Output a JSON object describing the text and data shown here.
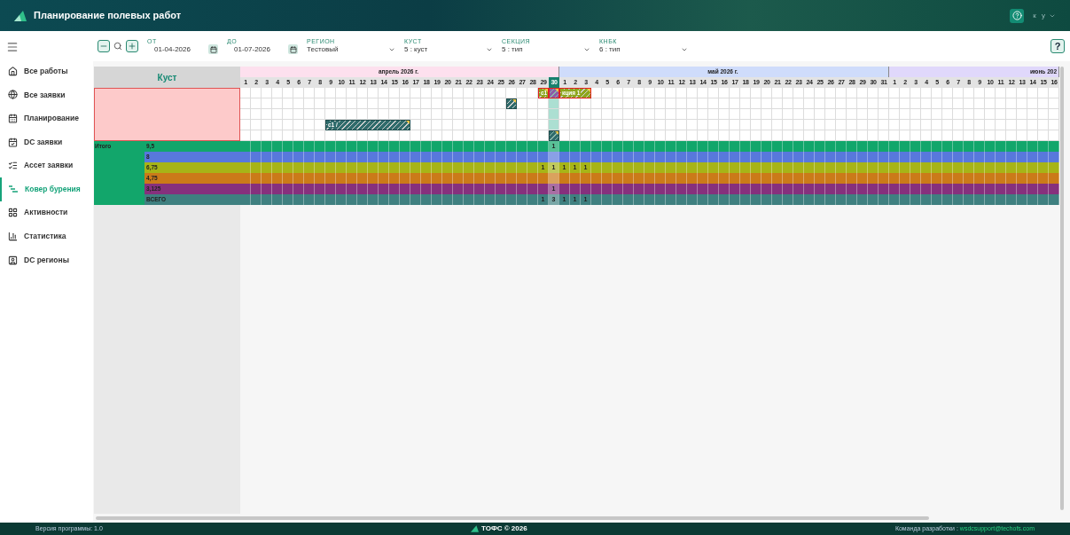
{
  "header": {
    "title": "Планирование полевых работ",
    "user": "к у"
  },
  "sidebar": {
    "items": [
      {
        "label": "Все работы",
        "selected": false
      },
      {
        "label": "Все заявки",
        "selected": false
      },
      {
        "label": "Планирование",
        "selected": false
      },
      {
        "label": "DC заявки",
        "selected": false
      },
      {
        "label": "Ассет заявки",
        "selected": false
      },
      {
        "label": "Ковер бурения",
        "selected": true
      },
      {
        "label": "Активности",
        "selected": false
      },
      {
        "label": "Статистика",
        "selected": false
      },
      {
        "label": "DC регионы",
        "selected": false
      }
    ]
  },
  "toolbar": {
    "date_from": {
      "label": "ОТ",
      "value": "01-04-2026"
    },
    "date_to": {
      "label": "ДО",
      "value": "01-07-2026"
    },
    "selects": [
      {
        "label": "РЕГИОН",
        "value": "Тестовый"
      },
      {
        "label": "КУСТ",
        "value": "5 : куст"
      },
      {
        "label": "СЕКЦИЯ",
        "value": "5 : тип"
      },
      {
        "label": "КНБК",
        "value": "6 : тип"
      }
    ],
    "help": "?"
  },
  "grid": {
    "left_title": "Куст",
    "months": [
      {
        "label": "апрель 2026 г.",
        "color": "#fde0ee",
        "days": [
          {
            "label": "1",
            "selected": false
          },
          {
            "label": "2",
            "selected": false
          },
          {
            "label": "3",
            "selected": false
          },
          {
            "label": "4",
            "selected": false
          },
          {
            "label": "5",
            "selected": false
          },
          {
            "label": "6",
            "selected": false
          },
          {
            "label": "7",
            "selected": false
          },
          {
            "label": "8",
            "selected": false
          },
          {
            "label": "9",
            "selected": false
          },
          {
            "label": "10",
            "selected": false
          },
          {
            "label": "11",
            "selected": false
          },
          {
            "label": "12",
            "selected": false
          },
          {
            "label": "13",
            "selected": false
          },
          {
            "label": "14",
            "selected": false
          },
          {
            "label": "15",
            "selected": false
          },
          {
            "label": "16",
            "selected": false
          },
          {
            "label": "17",
            "selected": false
          },
          {
            "label": "18",
            "selected": false
          },
          {
            "label": "19",
            "selected": false
          },
          {
            "label": "20",
            "selected": false
          },
          {
            "label": "21",
            "selected": false
          },
          {
            "label": "22",
            "selected": false
          },
          {
            "label": "23",
            "selected": false
          },
          {
            "label": "24",
            "selected": false
          },
          {
            "label": "25",
            "selected": false
          },
          {
            "label": "26",
            "selected": false
          },
          {
            "label": "27",
            "selected": false
          },
          {
            "label": "28",
            "selected": false
          },
          {
            "label": "29",
            "selected": false
          },
          {
            "label": "30",
            "selected": true
          }
        ]
      },
      {
        "label": "май 2026 г.",
        "color": "#cfdcfb",
        "days": [
          {
            "label": "1",
            "selected": false
          },
          {
            "label": "2",
            "selected": false
          },
          {
            "label": "3",
            "selected": false
          },
          {
            "label": "4",
            "selected": false
          },
          {
            "label": "5",
            "selected": false
          },
          {
            "label": "6",
            "selected": false
          },
          {
            "label": "7",
            "selected": false
          },
          {
            "label": "8",
            "selected": false
          },
          {
            "label": "9",
            "selected": false
          },
          {
            "label": "10",
            "selected": false
          },
          {
            "label": "11",
            "selected": false
          },
          {
            "label": "12",
            "selected": false
          },
          {
            "label": "13",
            "selected": false
          },
          {
            "label": "14",
            "selected": false
          },
          {
            "label": "15",
            "selected": false
          },
          {
            "label": "16",
            "selected": false
          },
          {
            "label": "17",
            "selected": false
          },
          {
            "label": "18",
            "selected": false
          },
          {
            "label": "19",
            "selected": false
          },
          {
            "label": "20",
            "selected": false
          },
          {
            "label": "21",
            "selected": false
          },
          {
            "label": "22",
            "selected": false
          },
          {
            "label": "23",
            "selected": false
          },
          {
            "label": "24",
            "selected": false
          },
          {
            "label": "25",
            "selected": false
          },
          {
            "label": "26",
            "selected": false
          },
          {
            "label": "27",
            "selected": false
          },
          {
            "label": "28",
            "selected": false
          },
          {
            "label": "29",
            "selected": false
          },
          {
            "label": "30",
            "selected": false
          },
          {
            "label": "31",
            "selected": false
          }
        ]
      },
      {
        "label": "июнь 202",
        "color": "#e0d8fb",
        "days": [
          {
            "label": "1",
            "selected": false
          },
          {
            "label": "2",
            "selected": false
          },
          {
            "label": "3",
            "selected": false
          },
          {
            "label": "4",
            "selected": false
          },
          {
            "label": "5",
            "selected": false
          },
          {
            "label": "6",
            "selected": false
          },
          {
            "label": "7",
            "selected": false
          },
          {
            "label": "8",
            "selected": false
          },
          {
            "label": "9",
            "selected": false
          },
          {
            "label": "10",
            "selected": false
          },
          {
            "label": "11",
            "selected": false
          },
          {
            "label": "12",
            "selected": false
          },
          {
            "label": "13",
            "selected": false
          },
          {
            "label": "14",
            "selected": false
          },
          {
            "label": "15",
            "selected": false
          },
          {
            "label": "16",
            "selected": false
          }
        ]
      }
    ],
    "task_rows": [
      {
        "cells": [
          {
            "kind": "empty"
          },
          {
            "kind": "empty"
          },
          {
            "kind": "empty"
          },
          {
            "kind": "empty"
          },
          {
            "kind": "empty"
          },
          {
            "kind": "empty"
          },
          {
            "kind": "empty"
          },
          {
            "kind": "empty"
          },
          {
            "kind": "empty"
          },
          {
            "kind": "empty"
          },
          {
            "kind": "empty"
          },
          {
            "kind": "empty"
          },
          {
            "kind": "empty"
          },
          {
            "kind": "empty"
          },
          {
            "kind": "empty"
          },
          {
            "kind": "empty"
          },
          {
            "kind": "empty"
          },
          {
            "kind": "empty"
          },
          {
            "kind": "empty"
          },
          {
            "kind": "empty"
          },
          {
            "kind": "empty"
          },
          {
            "kind": "empty"
          },
          {
            "kind": "empty"
          },
          {
            "kind": "empty"
          },
          {
            "kind": "empty"
          },
          {
            "kind": "empty"
          },
          {
            "kind": "empty"
          },
          {
            "kind": "empty"
          },
          {
            "kind": "bar_start",
            "label": "с1",
            "color": "#8ea51c",
            "conflict": true
          },
          {
            "kind": "bar_start",
            "color": "#8e5aa8",
            "conflict": true
          },
          {
            "kind": "bar_start",
            "label": "кция 1",
            "color": "#8ea51c",
            "conflict": true
          },
          {
            "kind": "bar_continue"
          },
          {
            "kind": "bar_continue"
          }
        ]
      },
      {
        "cells": [
          {
            "kind": "empty"
          },
          {
            "kind": "empty"
          },
          {
            "kind": "empty"
          },
          {
            "kind": "empty"
          },
          {
            "kind": "empty"
          },
          {
            "kind": "empty"
          },
          {
            "kind": "empty"
          },
          {
            "kind": "empty"
          },
          {
            "kind": "empty"
          },
          {
            "kind": "empty"
          },
          {
            "kind": "empty"
          },
          {
            "kind": "empty"
          },
          {
            "kind": "empty"
          },
          {
            "kind": "empty"
          },
          {
            "kind": "empty"
          },
          {
            "kind": "empty"
          },
          {
            "kind": "empty"
          },
          {
            "kind": "empty"
          },
          {
            "kind": "empty"
          },
          {
            "kind": "empty"
          },
          {
            "kind": "empty"
          },
          {
            "kind": "empty"
          },
          {
            "kind": "empty"
          },
          {
            "kind": "empty"
          },
          {
            "kind": "empty"
          },
          {
            "kind": "bar_start",
            "color": "#2f6b6b",
            "conflict": false
          }
        ]
      },
      {},
      {
        "cells": [
          {
            "kind": "empty"
          },
          {
            "kind": "empty"
          },
          {
            "kind": "empty"
          },
          {
            "kind": "empty"
          },
          {
            "kind": "empty"
          },
          {
            "kind": "empty"
          },
          {
            "kind": "empty"
          },
          {
            "kind": "empty"
          },
          {
            "kind": "bar_start",
            "label": "с1 /",
            "color": "#2f6b6b",
            "conflict": false
          },
          {
            "kind": "bar_continue"
          },
          {
            "kind": "bar_continue"
          },
          {
            "kind": "bar_continue"
          },
          {
            "kind": "bar_continue"
          },
          {
            "kind": "bar_continue"
          },
          {
            "kind": "bar_continue"
          },
          {
            "kind": "bar_continue"
          }
        ]
      },
      {
        "cells": [
          {
            "kind": "empty"
          },
          {
            "kind": "empty"
          },
          {
            "kind": "empty"
          },
          {
            "kind": "empty"
          },
          {
            "kind": "empty"
          },
          {
            "kind": "empty"
          },
          {
            "kind": "empty"
          },
          {
            "kind": "empty"
          },
          {
            "kind": "empty"
          },
          {
            "kind": "empty"
          },
          {
            "kind": "empty"
          },
          {
            "kind": "empty"
          },
          {
            "kind": "empty"
          },
          {
            "kind": "empty"
          },
          {
            "kind": "empty"
          },
          {
            "kind": "empty"
          },
          {
            "kind": "empty"
          },
          {
            "kind": "empty"
          },
          {
            "kind": "empty"
          },
          {
            "kind": "empty"
          },
          {
            "kind": "empty"
          },
          {
            "kind": "empty"
          },
          {
            "kind": "empty"
          },
          {
            "kind": "empty"
          },
          {
            "kind": "empty"
          },
          {
            "kind": "empty"
          },
          {
            "kind": "empty"
          },
          {
            "kind": "empty"
          },
          {
            "kind": "empty"
          },
          {
            "kind": "bar_start",
            "color": "#2f6b6b",
            "conflict": false
          }
        ]
      }
    ],
    "summary_title": "Итого",
    "summary_rows": [
      {
        "label": "9,5",
        "color": "#12a66b",
        "cells": [
          {
            "kind": "empty"
          },
          {
            "kind": "empty"
          },
          {
            "kind": "empty"
          },
          {
            "kind": "empty"
          },
          {
            "kind": "empty"
          },
          {
            "kind": "empty"
          },
          {
            "kind": "empty"
          },
          {
            "kind": "empty"
          },
          {
            "kind": "empty"
          },
          {
            "kind": "empty"
          },
          {
            "kind": "empty"
          },
          {
            "kind": "empty"
          },
          {
            "kind": "empty"
          },
          {
            "kind": "empty"
          },
          {
            "kind": "empty"
          },
          {
            "kind": "empty"
          },
          {
            "kind": "empty"
          },
          {
            "kind": "empty"
          },
          {
            "kind": "empty"
          },
          {
            "kind": "empty"
          },
          {
            "kind": "empty"
          },
          {
            "kind": "empty"
          },
          {
            "kind": "empty"
          },
          {
            "kind": "empty"
          },
          {
            "kind": "empty"
          },
          {
            "kind": "empty"
          },
          {
            "kind": "empty"
          },
          {
            "kind": "empty"
          },
          {
            "kind": "empty"
          },
          {
            "kind": "count",
            "text": "1"
          }
        ]
      },
      {
        "label": "8",
        "color": "#5878dc"
      },
      {
        "label": "6,75",
        "color": "#a7b417",
        "cells": [
          {
            "kind": "empty"
          },
          {
            "kind": "empty"
          },
          {
            "kind": "empty"
          },
          {
            "kind": "empty"
          },
          {
            "kind": "empty"
          },
          {
            "kind": "empty"
          },
          {
            "kind": "empty"
          },
          {
            "kind": "empty"
          },
          {
            "kind": "empty"
          },
          {
            "kind": "empty"
          },
          {
            "kind": "empty"
          },
          {
            "kind": "empty"
          },
          {
            "kind": "empty"
          },
          {
            "kind": "empty"
          },
          {
            "kind": "empty"
          },
          {
            "kind": "empty"
          },
          {
            "kind": "empty"
          },
          {
            "kind": "empty"
          },
          {
            "kind": "empty"
          },
          {
            "kind": "empty"
          },
          {
            "kind": "empty"
          },
          {
            "kind": "empty"
          },
          {
            "kind": "empty"
          },
          {
            "kind": "empty"
          },
          {
            "kind": "empty"
          },
          {
            "kind": "empty"
          },
          {
            "kind": "empty"
          },
          {
            "kind": "empty"
          },
          {
            "kind": "count",
            "text": "1"
          },
          {
            "kind": "count",
            "text": "1"
          },
          {
            "kind": "count",
            "text": "1"
          },
          {
            "kind": "count",
            "text": "1"
          },
          {
            "kind": "count",
            "text": "1"
          }
        ]
      },
      {
        "label": "4,75",
        "color": "#cb7a19"
      },
      {
        "label": "3,125",
        "color": "#86307d",
        "cells": [
          {
            "kind": "empty"
          },
          {
            "kind": "empty"
          },
          {
            "kind": "empty"
          },
          {
            "kind": "empty"
          },
          {
            "kind": "empty"
          },
          {
            "kind": "empty"
          },
          {
            "kind": "empty"
          },
          {
            "kind": "empty"
          },
          {
            "kind": "empty"
          },
          {
            "kind": "empty"
          },
          {
            "kind": "empty"
          },
          {
            "kind": "empty"
          },
          {
            "kind": "empty"
          },
          {
            "kind": "empty"
          },
          {
            "kind": "empty"
          },
          {
            "kind": "empty"
          },
          {
            "kind": "empty"
          },
          {
            "kind": "empty"
          },
          {
            "kind": "empty"
          },
          {
            "kind": "empty"
          },
          {
            "kind": "empty"
          },
          {
            "kind": "empty"
          },
          {
            "kind": "empty"
          },
          {
            "kind": "empty"
          },
          {
            "kind": "empty"
          },
          {
            "kind": "empty"
          },
          {
            "kind": "empty"
          },
          {
            "kind": "empty"
          },
          {
            "kind": "empty"
          },
          {
            "kind": "count",
            "text": "1"
          }
        ]
      },
      {
        "label": "ВСЕГО",
        "color": "#3f8080",
        "cells": [
          {
            "kind": "empty"
          },
          {
            "kind": "empty"
          },
          {
            "kind": "empty"
          },
          {
            "kind": "empty"
          },
          {
            "kind": "empty"
          },
          {
            "kind": "empty"
          },
          {
            "kind": "empty"
          },
          {
            "kind": "empty"
          },
          {
            "kind": "empty"
          },
          {
            "kind": "empty"
          },
          {
            "kind": "empty"
          },
          {
            "kind": "empty"
          },
          {
            "kind": "empty"
          },
          {
            "kind": "empty"
          },
          {
            "kind": "empty"
          },
          {
            "kind": "empty"
          },
          {
            "kind": "empty"
          },
          {
            "kind": "empty"
          },
          {
            "kind": "empty"
          },
          {
            "kind": "empty"
          },
          {
            "kind": "empty"
          },
          {
            "kind": "empty"
          },
          {
            "kind": "empty"
          },
          {
            "kind": "empty"
          },
          {
            "kind": "empty"
          },
          {
            "kind": "empty"
          },
          {
            "kind": "empty"
          },
          {
            "kind": "empty"
          },
          {
            "kind": "count",
            "text": "1"
          },
          {
            "kind": "count",
            "text": "3"
          },
          {
            "kind": "count",
            "text": "1"
          },
          {
            "kind": "count",
            "text": "1"
          },
          {
            "kind": "count",
            "text": "1"
          }
        ]
      }
    ]
  },
  "footer": {
    "version": "Версия программы: 1.0",
    "brand": "ТОФС © 2026",
    "team": "Команда разработки :",
    "email": "wsdcsupport@techofs.com"
  }
}
